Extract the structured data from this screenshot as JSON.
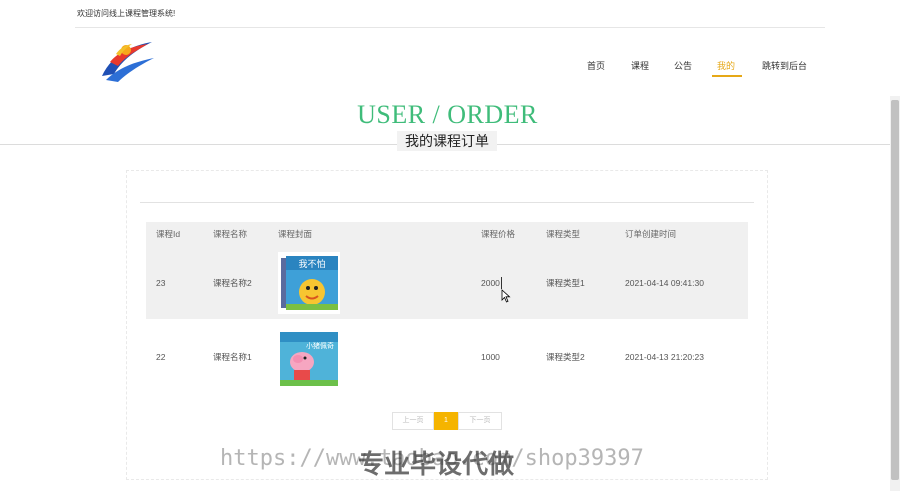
{
  "header": {
    "welcome": "欢迎访问线上课程管理系统!"
  },
  "nav": {
    "items": [
      {
        "label": "首页"
      },
      {
        "label": "课程"
      },
      {
        "label": "公告"
      },
      {
        "label": "我的"
      },
      {
        "label": "跳转到后台"
      }
    ],
    "active_index": 3
  },
  "hero": {
    "title": "USER / ORDER",
    "subtitle": "我的课程订单"
  },
  "table": {
    "columns": [
      "课程Id",
      "课程名称",
      "课程封面",
      "课程价格",
      "课程类型",
      "订单创建时间"
    ],
    "rows": [
      {
        "id": "23",
        "name": "课程名称2",
        "price": "2000",
        "type": "课程类型1",
        "created": "2021-04-14 09:41:30",
        "cover_text": "我不怕"
      },
      {
        "id": "22",
        "name": "课程名称1",
        "price": "1000",
        "type": "课程类型2",
        "created": "2021-04-13 21:20:23",
        "cover_text": "小猪佩奇"
      }
    ]
  },
  "pager": {
    "prev": "上一页",
    "current": "1",
    "next": "下一页"
  },
  "watermark": {
    "url": "https://www.taobao.com/shop39397",
    "text": "专业毕设代做"
  },
  "colors": {
    "accent": "#e6a817",
    "title_green": "#3fbc7a",
    "pager_active": "#f5b400"
  }
}
